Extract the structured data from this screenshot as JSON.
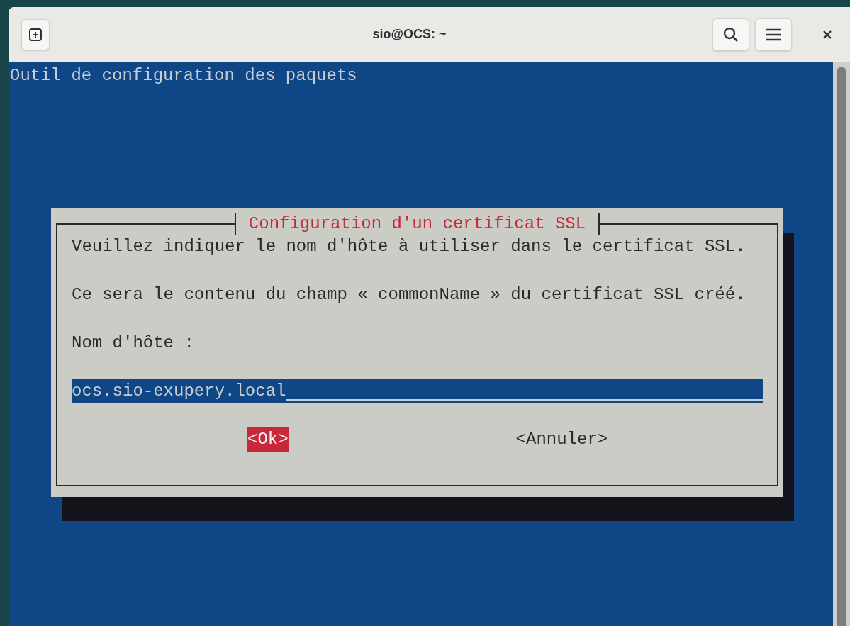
{
  "window": {
    "title": "sio@OCS: ~"
  },
  "terminal": {
    "heading": "Outil de configuration des paquets",
    "dialog": {
      "title": "Configuration d'un certificat SSL",
      "lines": [
        "Veuillez indiquer le nom d'hôte à utiliser dans le certificat SSL.",
        "Ce sera le contenu du champ « commonName » du certificat SSL créé.",
        "Nom d'hôte :"
      ],
      "field": {
        "value": "ocs.sio-exupery.local"
      },
      "buttons": [
        {
          "label": "<Ok>",
          "selected": true
        },
        {
          "label": "<Annuler>",
          "selected": false
        }
      ]
    }
  }
}
